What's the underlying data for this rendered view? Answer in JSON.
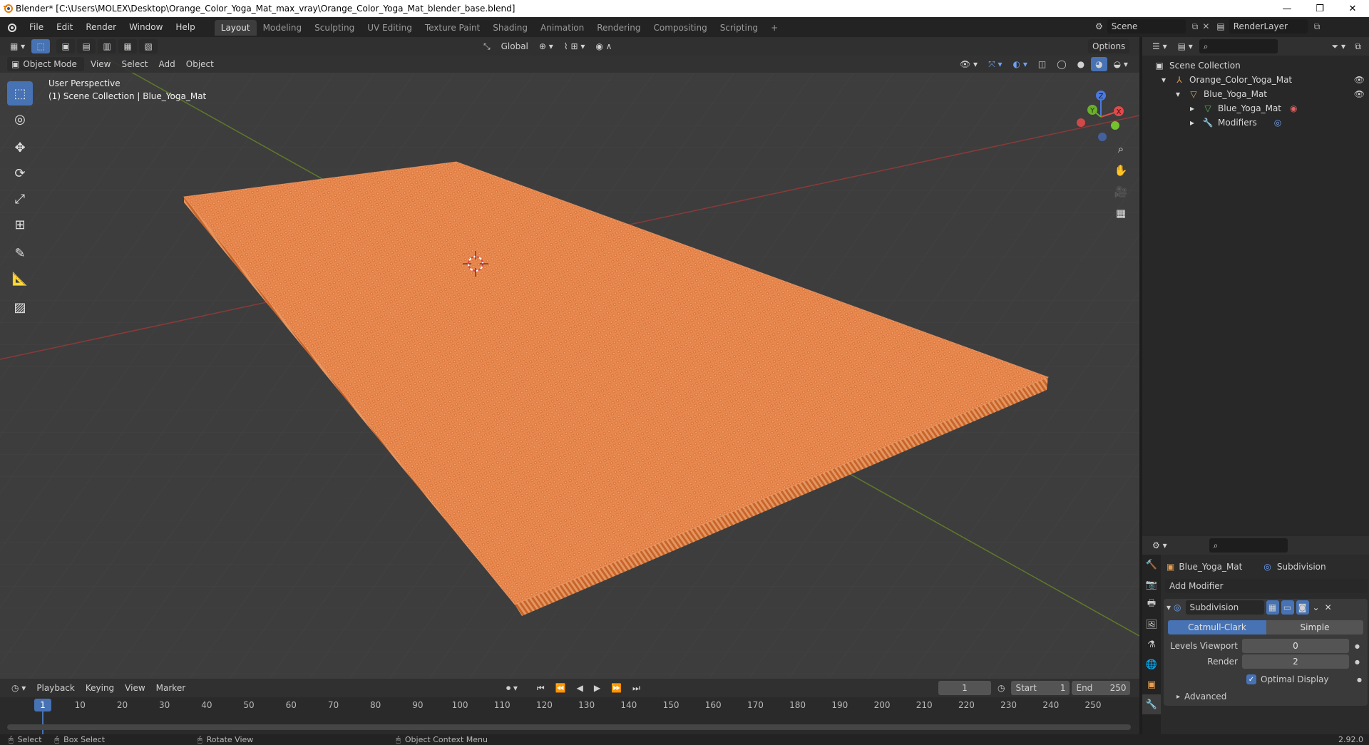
{
  "titlebar": {
    "title": "Blender* [C:\\Users\\MOLEX\\Desktop\\Orange_Color_Yoga_Mat_max_vray\\Orange_Color_Yoga_Mat_blender_base.blend]",
    "minimize": "—",
    "restore": "❐",
    "close": "✕"
  },
  "menu": {
    "items": [
      "File",
      "Edit",
      "Render",
      "Window",
      "Help"
    ],
    "workspaces": [
      "Layout",
      "Modeling",
      "Sculpting",
      "UV Editing",
      "Texture Paint",
      "Shading",
      "Animation",
      "Rendering",
      "Compositing",
      "Scripting"
    ],
    "active_workspace": "Layout",
    "add_tab": "+",
    "scene_label": "Scene",
    "render_layer": "RenderLayer"
  },
  "viewport": {
    "orientation": "Global",
    "options": "Options",
    "mode": "Object Mode",
    "menus": [
      "View",
      "Select",
      "Add",
      "Object"
    ],
    "overlay_line1": "User Perspective",
    "overlay_line2": "(1) Scene Collection | Blue_Yoga_Mat",
    "mat_color": "#e8884e",
    "gizmo": {
      "x": "X",
      "y": "Y",
      "z": "Z"
    }
  },
  "timeline": {
    "menus": [
      "Playback",
      "Keying",
      "View",
      "Marker"
    ],
    "current_frame": "1",
    "start_label": "Start",
    "start_value": "1",
    "end_label": "End",
    "end_value": "250",
    "frame_labels": [
      "1",
      "10",
      "20",
      "30",
      "40",
      "50",
      "60",
      "70",
      "80",
      "90",
      "100",
      "110",
      "120",
      "130",
      "140",
      "150",
      "160",
      "170",
      "180",
      "190",
      "200",
      "210",
      "220",
      "230",
      "240",
      "250"
    ]
  },
  "statusbar": {
    "select": "Select",
    "box_select": "Box Select",
    "rotate_view": "Rotate View",
    "context_menu": "Object Context Menu",
    "version": "2.92.0"
  },
  "outliner": {
    "root": "Scene Collection",
    "collection": "Orange_Color_Yoga_Mat",
    "object": "Blue_Yoga_Mat",
    "mesh": "Blue_Yoga_Mat",
    "modifiers": "Modifiers"
  },
  "properties": {
    "object_name": "Blue_Yoga_Mat",
    "modifier_crumb": "Subdivision",
    "add_modifier": "Add Modifier",
    "modifier_name": "Subdivision",
    "catmull": "Catmull-Clark",
    "simple": "Simple",
    "levels_viewport_label": "Levels Viewport",
    "levels_viewport_value": "0",
    "render_label": "Render",
    "render_value": "2",
    "optimal_display": "Optimal Display",
    "advanced": "Advanced"
  }
}
